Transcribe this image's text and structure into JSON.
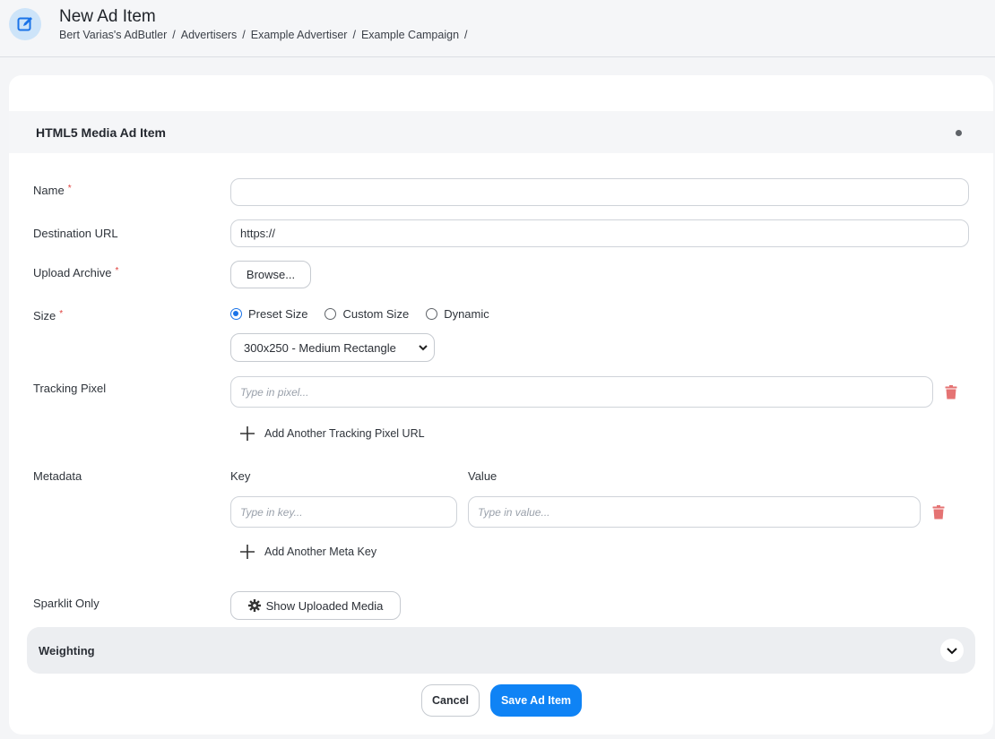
{
  "header": {
    "title": "New Ad Item",
    "breadcrumb": [
      "Bert Varias's AdButler",
      "Advertisers",
      "Example Advertiser",
      "Example Campaign"
    ],
    "separator": "/",
    "icon": "edit-icon"
  },
  "section": {
    "title": "HTML5 Media Ad Item"
  },
  "form": {
    "name": {
      "label": "Name",
      "required": "*",
      "value": ""
    },
    "destination_url": {
      "label": "Destination URL",
      "value": "https://"
    },
    "upload_archive": {
      "label": "Upload Archive",
      "required": "*",
      "button": "Browse..."
    },
    "size": {
      "label": "Size",
      "required": "*",
      "options": [
        "Preset Size",
        "Custom Size",
        "Dynamic"
      ],
      "selected_option": "Preset Size",
      "preset_value": "300x250 - Medium Rectangle"
    },
    "tracking_pixel": {
      "label": "Tracking Pixel",
      "placeholder": "Type in pixel...",
      "add_label": "Add Another Tracking Pixel URL"
    },
    "metadata": {
      "label": "Metadata",
      "key_header": "Key",
      "value_header": "Value",
      "key_placeholder": "Type in key...",
      "value_placeholder": "Type in value...",
      "add_label": "Add Another Meta Key"
    },
    "sparklit_only": {
      "label": "Sparklit Only",
      "button": "Show Uploaded Media"
    }
  },
  "weighting": {
    "label": "Weighting"
  },
  "actions": {
    "cancel": "Cancel",
    "save": "Save Ad Item"
  },
  "colors": {
    "accent": "#0f83f5",
    "required": "#e0403c",
    "trash": "#e57373"
  }
}
